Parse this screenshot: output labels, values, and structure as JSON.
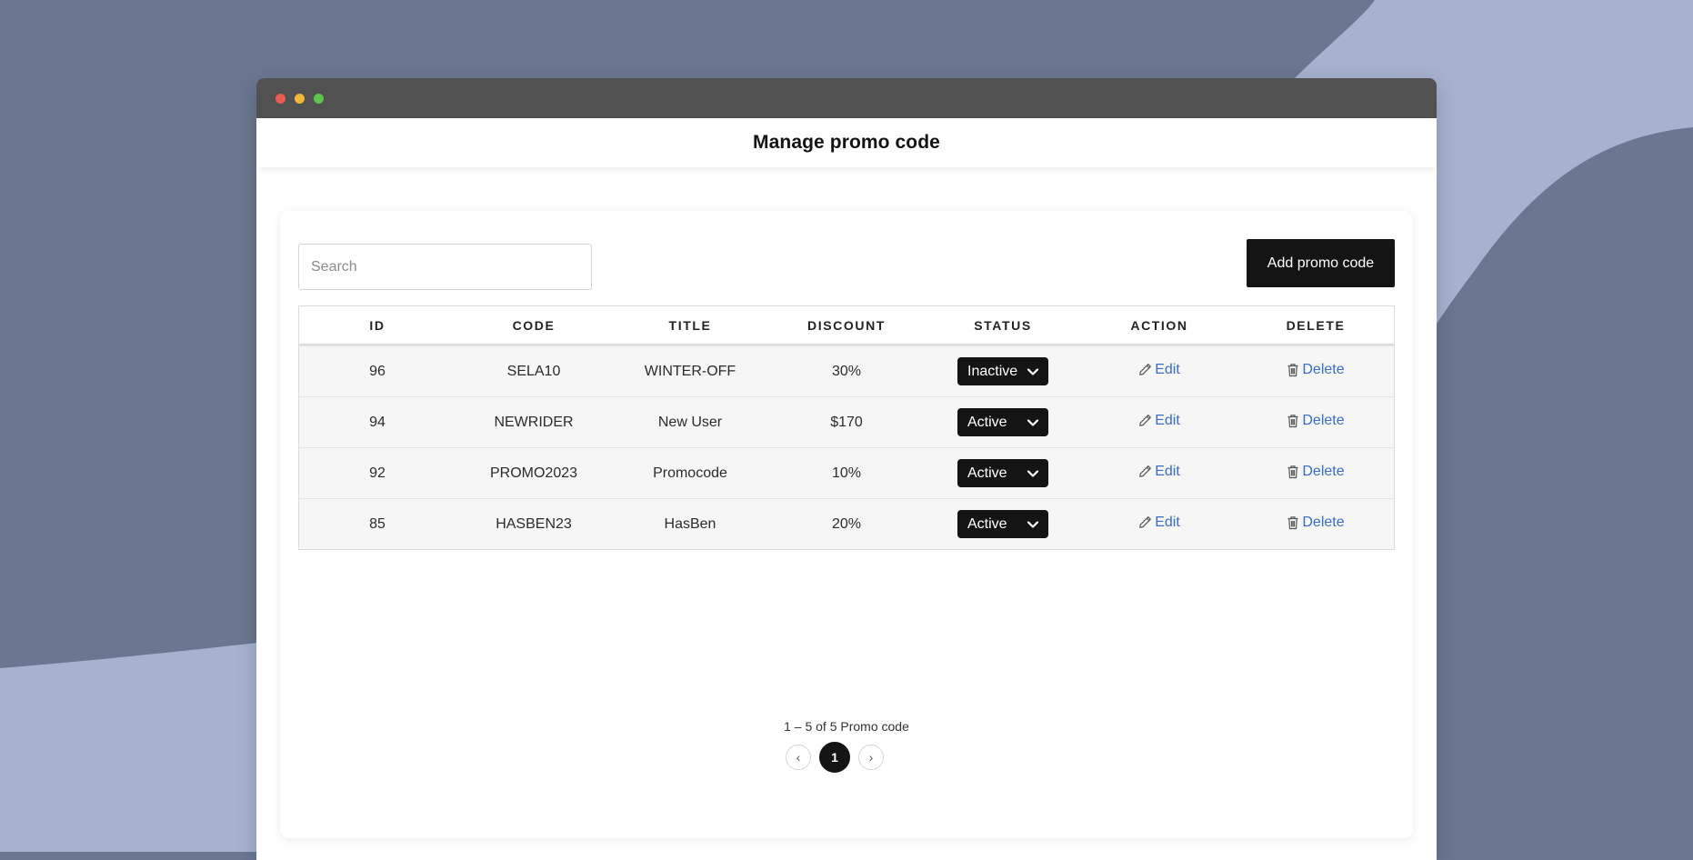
{
  "page": {
    "title": "Manage promo code"
  },
  "toolbar": {
    "search_placeholder": "Search",
    "add_label": "Add promo code"
  },
  "table": {
    "headers": [
      "ID",
      "CODE",
      "TITLE",
      "DISCOUNT",
      "STATUS",
      "ACTION",
      "DELETE"
    ],
    "rows": [
      {
        "id": "96",
        "code": "SELA10",
        "title": "WINTER-OFF",
        "discount": "30%",
        "status": "Inactive",
        "action": "Edit",
        "delete": "Delete"
      },
      {
        "id": "94",
        "code": "NEWRIDER",
        "title": "New User",
        "discount": "$170",
        "status": "Active",
        "action": "Edit",
        "delete": "Delete"
      },
      {
        "id": "92",
        "code": "PROMO2023",
        "title": "Promocode",
        "discount": "10%",
        "status": "Active",
        "action": "Edit",
        "delete": "Delete"
      },
      {
        "id": "85",
        "code": "HASBEN23",
        "title": "HasBen",
        "discount": "20%",
        "status": "Active",
        "action": "Edit",
        "delete": "Delete"
      }
    ]
  },
  "pagination": {
    "summary": "1 – 5 of 5 Promo code",
    "prev": "‹",
    "current": "1",
    "next": "›"
  },
  "colors": {
    "background": "#6b7791",
    "accent_shape": "#a7b2cf",
    "titlebar": "#515151",
    "button": "#141414",
    "link": "#3b6cc9"
  },
  "icons": {
    "edit": "pencil-icon",
    "delete": "trash-icon",
    "status": "chevron-down-icon"
  }
}
